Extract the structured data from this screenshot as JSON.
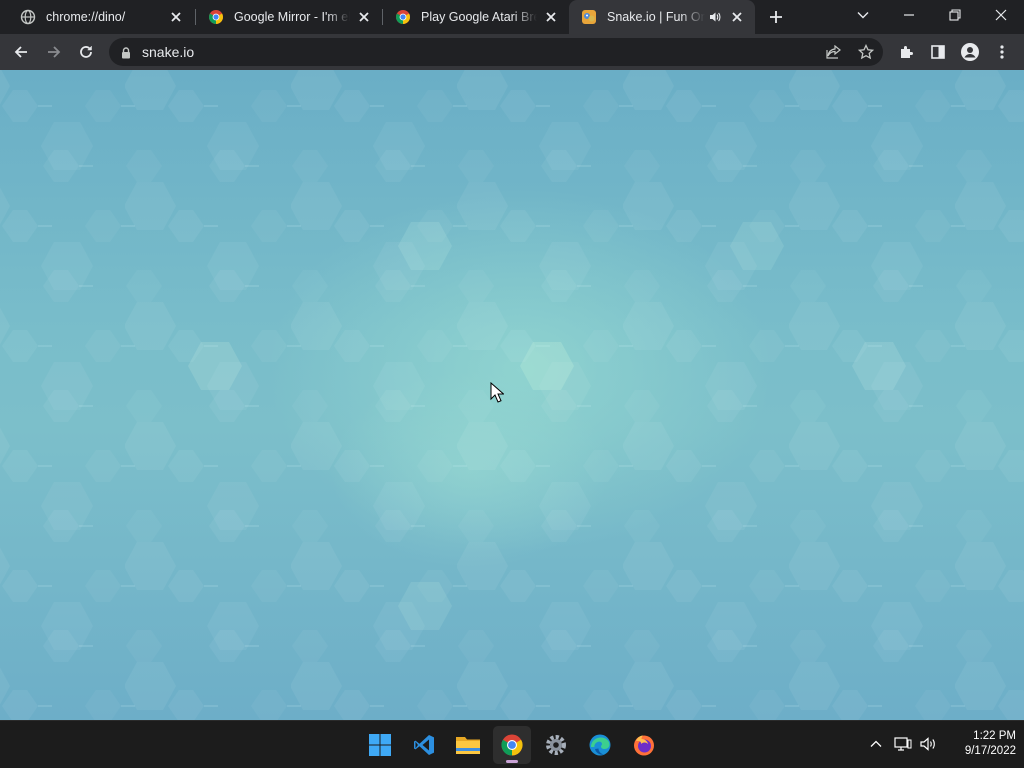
{
  "tabs": [
    {
      "title": "chrome://dino/",
      "favicon": "globe-icon"
    },
    {
      "title": "Google Mirror - I'm elgoog",
      "favicon": "chrome-icon"
    },
    {
      "title": "Play Google Atari Breakout",
      "favicon": "chrome-icon"
    },
    {
      "title": "Snake.io | Fun Online",
      "favicon": "snake-io-icon",
      "active": true,
      "audible": true
    }
  ],
  "address_bar": {
    "url": "snake.io"
  },
  "colors": {
    "tab_bg": "#202124",
    "toolbar_bg": "#35363a",
    "page_teal": "#7cbfca",
    "taskbar_bg": "#1c1c1c"
  },
  "taskbar": {
    "apps": [
      "start-icon",
      "vscode-icon",
      "file-explorer-icon",
      "chrome-icon",
      "settings-icon",
      "edge-icon",
      "firefox-icon"
    ],
    "active_app": "chrome-icon",
    "clock": {
      "time": "1:22 PM",
      "date": "9/17/2022"
    }
  }
}
